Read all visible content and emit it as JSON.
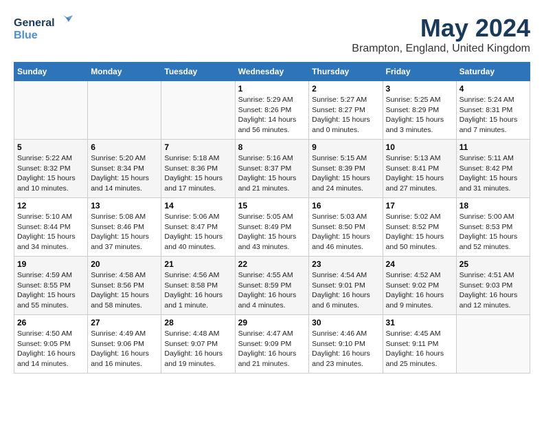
{
  "header": {
    "logo_general": "General",
    "logo_blue": "Blue",
    "month": "May 2024",
    "location": "Brampton, England, United Kingdom"
  },
  "days_of_week": [
    "Sunday",
    "Monday",
    "Tuesday",
    "Wednesday",
    "Thursday",
    "Friday",
    "Saturday"
  ],
  "weeks": [
    [
      {
        "day": "",
        "info": ""
      },
      {
        "day": "",
        "info": ""
      },
      {
        "day": "",
        "info": ""
      },
      {
        "day": "1",
        "info": "Sunrise: 5:29 AM\nSunset: 8:26 PM\nDaylight: 14 hours\nand 56 minutes."
      },
      {
        "day": "2",
        "info": "Sunrise: 5:27 AM\nSunset: 8:27 PM\nDaylight: 15 hours\nand 0 minutes."
      },
      {
        "day": "3",
        "info": "Sunrise: 5:25 AM\nSunset: 8:29 PM\nDaylight: 15 hours\nand 3 minutes."
      },
      {
        "day": "4",
        "info": "Sunrise: 5:24 AM\nSunset: 8:31 PM\nDaylight: 15 hours\nand 7 minutes."
      }
    ],
    [
      {
        "day": "5",
        "info": "Sunrise: 5:22 AM\nSunset: 8:32 PM\nDaylight: 15 hours\nand 10 minutes."
      },
      {
        "day": "6",
        "info": "Sunrise: 5:20 AM\nSunset: 8:34 PM\nDaylight: 15 hours\nand 14 minutes."
      },
      {
        "day": "7",
        "info": "Sunrise: 5:18 AM\nSunset: 8:36 PM\nDaylight: 15 hours\nand 17 minutes."
      },
      {
        "day": "8",
        "info": "Sunrise: 5:16 AM\nSunset: 8:37 PM\nDaylight: 15 hours\nand 21 minutes."
      },
      {
        "day": "9",
        "info": "Sunrise: 5:15 AM\nSunset: 8:39 PM\nDaylight: 15 hours\nand 24 minutes."
      },
      {
        "day": "10",
        "info": "Sunrise: 5:13 AM\nSunset: 8:41 PM\nDaylight: 15 hours\nand 27 minutes."
      },
      {
        "day": "11",
        "info": "Sunrise: 5:11 AM\nSunset: 8:42 PM\nDaylight: 15 hours\nand 31 minutes."
      }
    ],
    [
      {
        "day": "12",
        "info": "Sunrise: 5:10 AM\nSunset: 8:44 PM\nDaylight: 15 hours\nand 34 minutes."
      },
      {
        "day": "13",
        "info": "Sunrise: 5:08 AM\nSunset: 8:46 PM\nDaylight: 15 hours\nand 37 minutes."
      },
      {
        "day": "14",
        "info": "Sunrise: 5:06 AM\nSunset: 8:47 PM\nDaylight: 15 hours\nand 40 minutes."
      },
      {
        "day": "15",
        "info": "Sunrise: 5:05 AM\nSunset: 8:49 PM\nDaylight: 15 hours\nand 43 minutes."
      },
      {
        "day": "16",
        "info": "Sunrise: 5:03 AM\nSunset: 8:50 PM\nDaylight: 15 hours\nand 46 minutes."
      },
      {
        "day": "17",
        "info": "Sunrise: 5:02 AM\nSunset: 8:52 PM\nDaylight: 15 hours\nand 50 minutes."
      },
      {
        "day": "18",
        "info": "Sunrise: 5:00 AM\nSunset: 8:53 PM\nDaylight: 15 hours\nand 52 minutes."
      }
    ],
    [
      {
        "day": "19",
        "info": "Sunrise: 4:59 AM\nSunset: 8:55 PM\nDaylight: 15 hours\nand 55 minutes."
      },
      {
        "day": "20",
        "info": "Sunrise: 4:58 AM\nSunset: 8:56 PM\nDaylight: 15 hours\nand 58 minutes."
      },
      {
        "day": "21",
        "info": "Sunrise: 4:56 AM\nSunset: 8:58 PM\nDaylight: 16 hours\nand 1 minute."
      },
      {
        "day": "22",
        "info": "Sunrise: 4:55 AM\nSunset: 8:59 PM\nDaylight: 16 hours\nand 4 minutes."
      },
      {
        "day": "23",
        "info": "Sunrise: 4:54 AM\nSunset: 9:01 PM\nDaylight: 16 hours\nand 6 minutes."
      },
      {
        "day": "24",
        "info": "Sunrise: 4:52 AM\nSunset: 9:02 PM\nDaylight: 16 hours\nand 9 minutes."
      },
      {
        "day": "25",
        "info": "Sunrise: 4:51 AM\nSunset: 9:03 PM\nDaylight: 16 hours\nand 12 minutes."
      }
    ],
    [
      {
        "day": "26",
        "info": "Sunrise: 4:50 AM\nSunset: 9:05 PM\nDaylight: 16 hours\nand 14 minutes."
      },
      {
        "day": "27",
        "info": "Sunrise: 4:49 AM\nSunset: 9:06 PM\nDaylight: 16 hours\nand 16 minutes."
      },
      {
        "day": "28",
        "info": "Sunrise: 4:48 AM\nSunset: 9:07 PM\nDaylight: 16 hours\nand 19 minutes."
      },
      {
        "day": "29",
        "info": "Sunrise: 4:47 AM\nSunset: 9:09 PM\nDaylight: 16 hours\nand 21 minutes."
      },
      {
        "day": "30",
        "info": "Sunrise: 4:46 AM\nSunset: 9:10 PM\nDaylight: 16 hours\nand 23 minutes."
      },
      {
        "day": "31",
        "info": "Sunrise: 4:45 AM\nSunset: 9:11 PM\nDaylight: 16 hours\nand 25 minutes."
      },
      {
        "day": "",
        "info": ""
      }
    ]
  ]
}
